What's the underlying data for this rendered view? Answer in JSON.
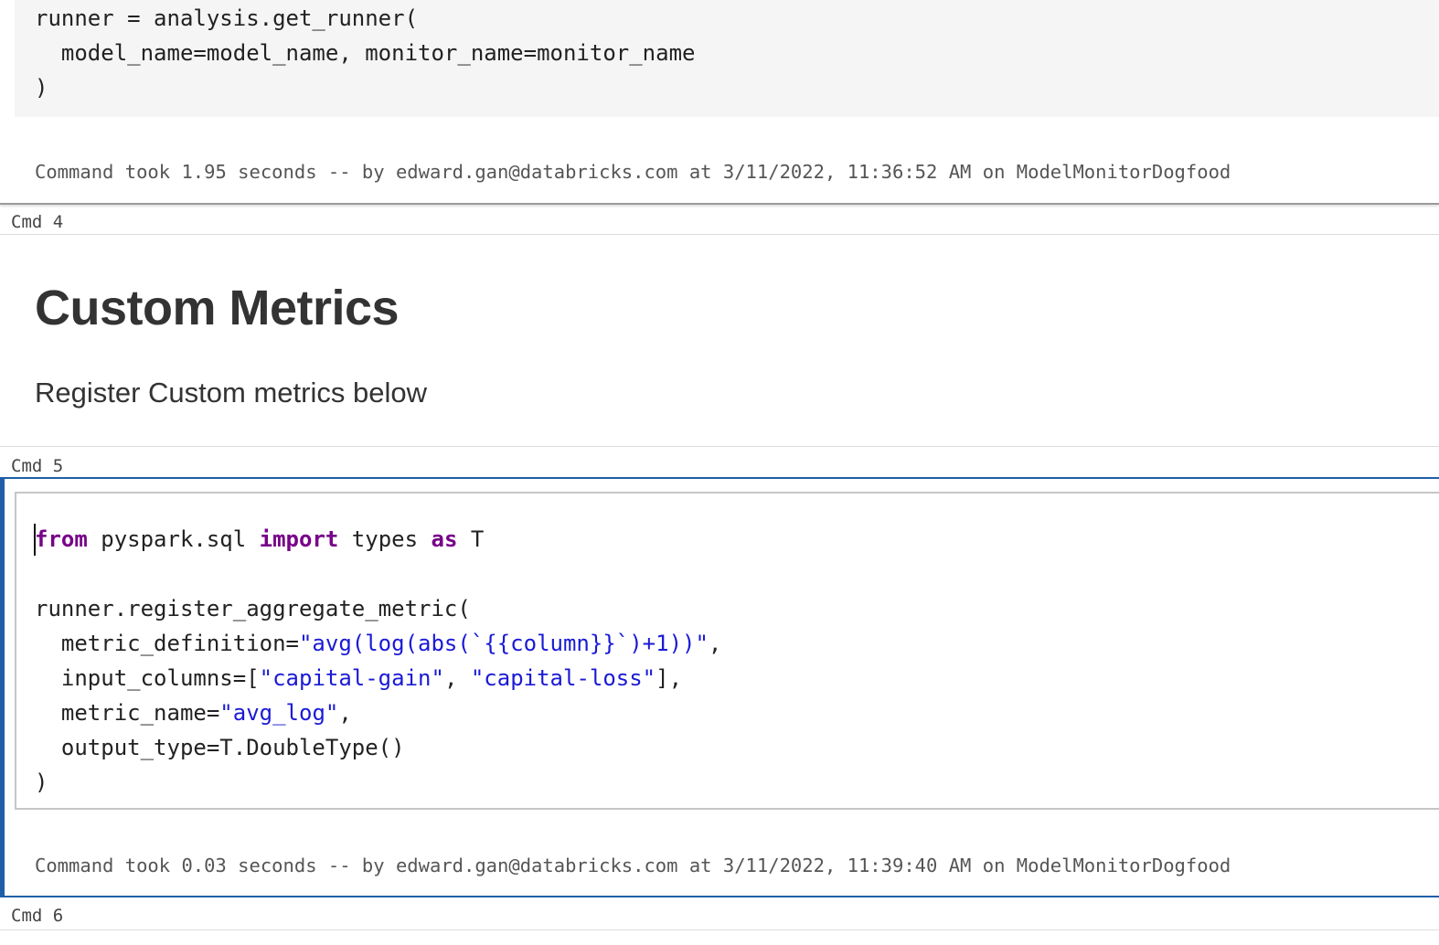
{
  "cells": {
    "cell3": {
      "code_lines": [
        "runner = analysis.get_runner(",
        "  model_name=model_name, monitor_name=monitor_name",
        ")"
      ],
      "result": "Command took 1.95 seconds -- by edward.gan@databricks.com at 3/11/2022, 11:36:52 AM on ModelMonitorDogfood"
    },
    "cell4": {
      "label": "Cmd 4",
      "title": "Custom Metrics",
      "text": "Register Custom metrics below"
    },
    "cell5": {
      "label": "Cmd 5",
      "code": {
        "line1": {
          "kw_from": "from",
          "mod": " pyspark.sql ",
          "kw_import": "import",
          "name": " types ",
          "kw_as": "as",
          "alias": " T"
        },
        "line3": "runner.register_aggregate_metric(",
        "line4": {
          "prefix": "  metric_definition=",
          "str": "\"avg(log(abs(`{{column}}`)+1))\"",
          "suffix": ","
        },
        "line5": {
          "prefix": "  input_columns=[",
          "str1": "\"capital-gain\"",
          "mid": ", ",
          "str2": "\"capital-loss\"",
          "suffix": "],"
        },
        "line6": {
          "prefix": "  metric_name=",
          "str": "\"avg_log\"",
          "suffix": ","
        },
        "line7": "  output_type=T.DoubleType()",
        "line8": ")"
      },
      "result": "Command took 0.03 seconds -- by edward.gan@databricks.com at 3/11/2022, 11:39:40 AM on ModelMonitorDogfood"
    },
    "cell6": {
      "label": "Cmd 6"
    }
  },
  "colors": {
    "keyword": "#770088",
    "string": "#1a1ad6",
    "selected_cell_border": "#1f5fa8"
  }
}
